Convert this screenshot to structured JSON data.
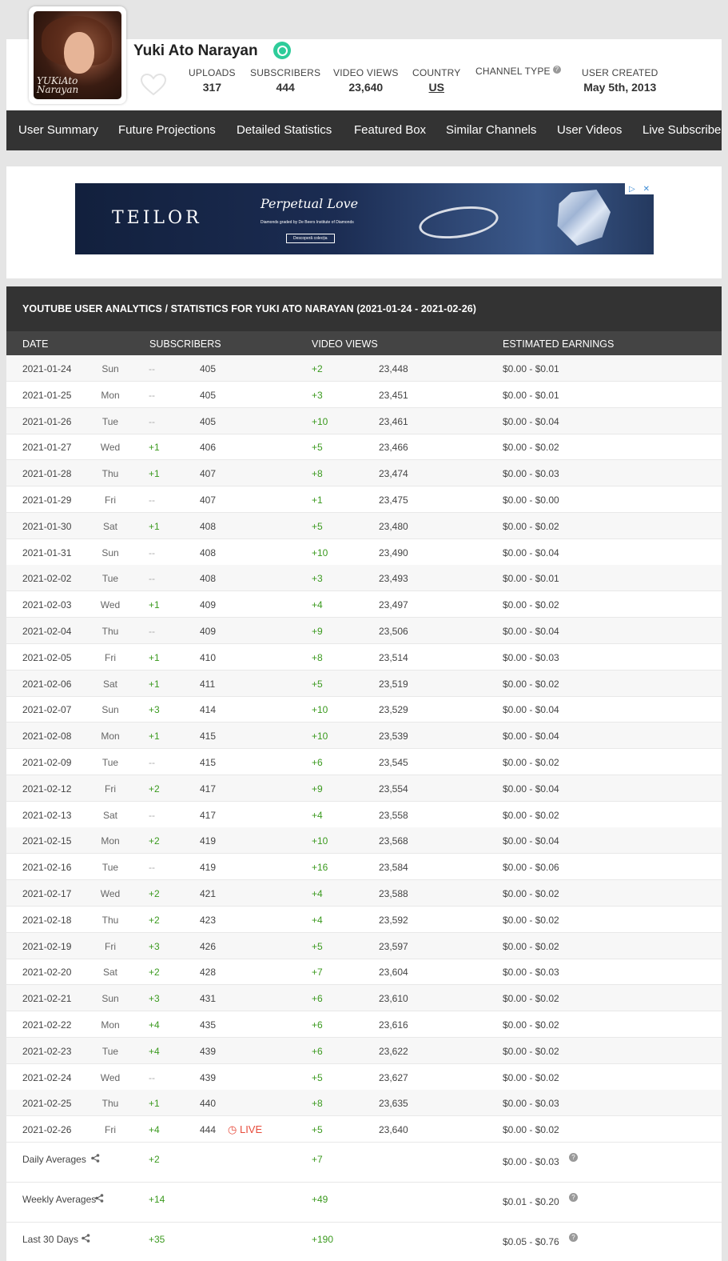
{
  "profile": {
    "name": "Yuki Ato Narayan",
    "avatar_watermark": "YUKiAto Narayan",
    "stats": [
      {
        "label": "UPLOADS",
        "value": "317"
      },
      {
        "label": "SUBSCRIBERS",
        "value": "444"
      },
      {
        "label": "VIDEO VIEWS",
        "value": "23,640"
      },
      {
        "label": "COUNTRY",
        "value": "US"
      },
      {
        "label": "CHANNEL TYPE",
        "value": ""
      },
      {
        "label": "USER CREATED",
        "value": "May 5th, 2013"
      }
    ],
    "accent_color": "#2ecc9a"
  },
  "nav": {
    "items": [
      "User Summary",
      "Future Projections",
      "Detailed Statistics",
      "Featured Box",
      "Similar Channels",
      "User Videos",
      "Live Subscriber"
    ]
  },
  "ad": {
    "brand": "TEILOR",
    "title": "Perpetual Love",
    "subtitle": "Diamonds graded by De Beers Institute of Diamonds",
    "button": "Descoperă colecția",
    "choices_icons": [
      "adchoices-icon",
      "close-icon"
    ]
  },
  "stats_table": {
    "title": "YOUTUBE USER ANALYTICS / STATISTICS FOR YUKI ATO NARAYAN (2021-01-24 - 2021-02-26)",
    "columns": [
      "DATE",
      "SUBSCRIBERS",
      "VIDEO VIEWS",
      "ESTIMATED EARNINGS"
    ],
    "live_label": "LIVE",
    "rows": [
      {
        "date": "2021-01-24",
        "day": "Sun",
        "sub_change": "--",
        "subs": "405",
        "view_change": "+2",
        "views": "23,448",
        "earnings": "$0.00  -  $0.01"
      },
      {
        "date": "2021-01-25",
        "day": "Mon",
        "sub_change": "--",
        "subs": "405",
        "view_change": "+3",
        "views": "23,451",
        "earnings": "$0.00  -  $0.01"
      },
      {
        "date": "2021-01-26",
        "day": "Tue",
        "sub_change": "--",
        "subs": "405",
        "view_change": "+10",
        "views": "23,461",
        "earnings": "$0.00  -  $0.04"
      },
      {
        "date": "2021-01-27",
        "day": "Wed",
        "sub_change": "+1",
        "subs": "406",
        "view_change": "+5",
        "views": "23,466",
        "earnings": "$0.00  -  $0.02"
      },
      {
        "date": "2021-01-28",
        "day": "Thu",
        "sub_change": "+1",
        "subs": "407",
        "view_change": "+8",
        "views": "23,474",
        "earnings": "$0.00  -  $0.03"
      },
      {
        "date": "2021-01-29",
        "day": "Fri",
        "sub_change": "--",
        "subs": "407",
        "view_change": "+1",
        "views": "23,475",
        "earnings": "$0.00  -  $0.00"
      },
      {
        "date": "2021-01-30",
        "day": "Sat",
        "sub_change": "+1",
        "subs": "408",
        "view_change": "+5",
        "views": "23,480",
        "earnings": "$0.00  -  $0.02"
      },
      {
        "date": "2021-01-31",
        "day": "Sun",
        "sub_change": "--",
        "subs": "408",
        "view_change": "+10",
        "views": "23,490",
        "earnings": "$0.00  -  $0.04"
      },
      {
        "date": "2021-02-02",
        "day": "Tue",
        "sub_change": "--",
        "subs": "408",
        "view_change": "+3",
        "views": "23,493",
        "earnings": "$0.00  -  $0.01"
      },
      {
        "date": "2021-02-03",
        "day": "Wed",
        "sub_change": "+1",
        "subs": "409",
        "view_change": "+4",
        "views": "23,497",
        "earnings": "$0.00  -  $0.02"
      },
      {
        "date": "2021-02-04",
        "day": "Thu",
        "sub_change": "--",
        "subs": "409",
        "view_change": "+9",
        "views": "23,506",
        "earnings": "$0.00  -  $0.04"
      },
      {
        "date": "2021-02-05",
        "day": "Fri",
        "sub_change": "+1",
        "subs": "410",
        "view_change": "+8",
        "views": "23,514",
        "earnings": "$0.00  -  $0.03"
      },
      {
        "date": "2021-02-06",
        "day": "Sat",
        "sub_change": "+1",
        "subs": "411",
        "view_change": "+5",
        "views": "23,519",
        "earnings": "$0.00  -  $0.02"
      },
      {
        "date": "2021-02-07",
        "day": "Sun",
        "sub_change": "+3",
        "subs": "414",
        "view_change": "+10",
        "views": "23,529",
        "earnings": "$0.00  -  $0.04"
      },
      {
        "date": "2021-02-08",
        "day": "Mon",
        "sub_change": "+1",
        "subs": "415",
        "view_change": "+10",
        "views": "23,539",
        "earnings": "$0.00  -  $0.04"
      },
      {
        "date": "2021-02-09",
        "day": "Tue",
        "sub_change": "--",
        "subs": "415",
        "view_change": "+6",
        "views": "23,545",
        "earnings": "$0.00  -  $0.02"
      },
      {
        "date": "2021-02-12",
        "day": "Fri",
        "sub_change": "+2",
        "subs": "417",
        "view_change": "+9",
        "views": "23,554",
        "earnings": "$0.00  -  $0.04"
      },
      {
        "date": "2021-02-13",
        "day": "Sat",
        "sub_change": "--",
        "subs": "417",
        "view_change": "+4",
        "views": "23,558",
        "earnings": "$0.00  -  $0.02"
      },
      {
        "date": "2021-02-15",
        "day": "Mon",
        "sub_change": "+2",
        "subs": "419",
        "view_change": "+10",
        "views": "23,568",
        "earnings": "$0.00  -  $0.04"
      },
      {
        "date": "2021-02-16",
        "day": "Tue",
        "sub_change": "--",
        "subs": "419",
        "view_change": "+16",
        "views": "23,584",
        "earnings": "$0.00  -  $0.06"
      },
      {
        "date": "2021-02-17",
        "day": "Wed",
        "sub_change": "+2",
        "subs": "421",
        "view_change": "+4",
        "views": "23,588",
        "earnings": "$0.00  -  $0.02"
      },
      {
        "date": "2021-02-18",
        "day": "Thu",
        "sub_change": "+2",
        "subs": "423",
        "view_change": "+4",
        "views": "23,592",
        "earnings": "$0.00  -  $0.02"
      },
      {
        "date": "2021-02-19",
        "day": "Fri",
        "sub_change": "+3",
        "subs": "426",
        "view_change": "+5",
        "views": "23,597",
        "earnings": "$0.00  -  $0.02"
      },
      {
        "date": "2021-02-20",
        "day": "Sat",
        "sub_change": "+2",
        "subs": "428",
        "view_change": "+7",
        "views": "23,604",
        "earnings": "$0.00  -  $0.03"
      },
      {
        "date": "2021-02-21",
        "day": "Sun",
        "sub_change": "+3",
        "subs": "431",
        "view_change": "+6",
        "views": "23,610",
        "earnings": "$0.00  -  $0.02"
      },
      {
        "date": "2021-02-22",
        "day": "Mon",
        "sub_change": "+4",
        "subs": "435",
        "view_change": "+6",
        "views": "23,616",
        "earnings": "$0.00  -  $0.02"
      },
      {
        "date": "2021-02-23",
        "day": "Tue",
        "sub_change": "+4",
        "subs": "439",
        "view_change": "+6",
        "views": "23,622",
        "earnings": "$0.00  -  $0.02"
      },
      {
        "date": "2021-02-24",
        "day": "Wed",
        "sub_change": "--",
        "subs": "439",
        "view_change": "+5",
        "views": "23,627",
        "earnings": "$0.00  -  $0.02"
      },
      {
        "date": "2021-02-25",
        "day": "Thu",
        "sub_change": "+1",
        "subs": "440",
        "view_change": "+8",
        "views": "23,635",
        "earnings": "$0.00  -  $0.03"
      },
      {
        "date": "2021-02-26",
        "day": "Fri",
        "sub_change": "+4",
        "subs": "444",
        "view_change": "+5",
        "views": "23,640",
        "earnings": "$0.00  -  $0.02",
        "live": true
      }
    ],
    "summary": [
      {
        "label": "Daily Averages",
        "subs": "+2",
        "views": "+7",
        "earnings": "$0.00  -  $0.03"
      },
      {
        "label": "Weekly Averages",
        "subs": "+14",
        "views": "+49",
        "earnings": "$0.01  -  $0.20"
      },
      {
        "label": "Last 30 Days",
        "subs": "+35",
        "views": "+190",
        "earnings": "$0.05  -  $0.76"
      }
    ]
  }
}
